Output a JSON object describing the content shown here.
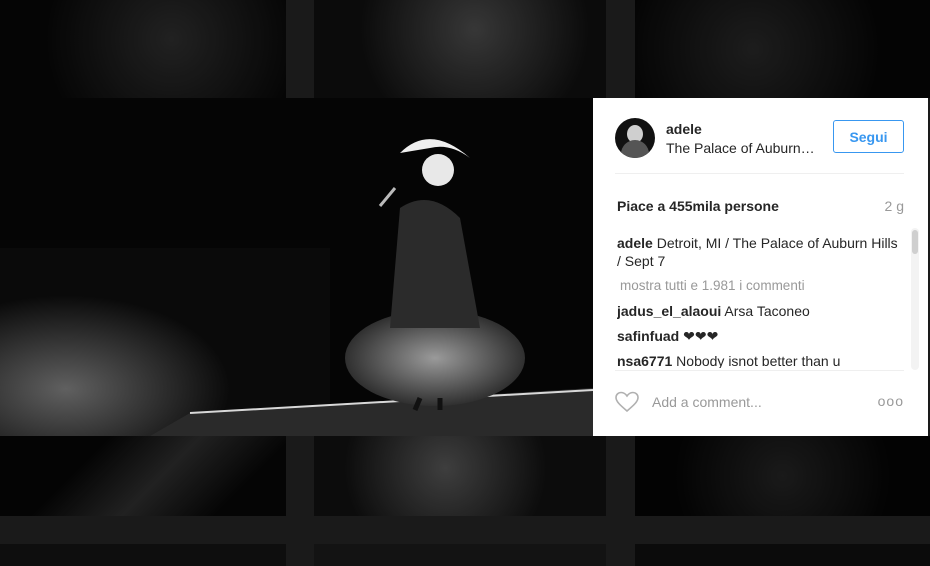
{
  "post": {
    "username": "adele",
    "location": "The Palace of Auburn Hills",
    "follow_label": "Segui",
    "likes_text": "Piace a 455mila persone",
    "age": "2 g",
    "caption": {
      "user": "adele",
      "text": "Detroit, MI / The Palace of Auburn Hills / Sept 7"
    },
    "view_all_comments": "mostra tutti e 1.981 i commenti",
    "comments": [
      {
        "user": "jadus_el_alaoui",
        "text": "Arsa Taconeo"
      },
      {
        "user": "safinfuad",
        "text": "❤❤❤"
      },
      {
        "user": "nsa6771",
        "text": "Nobody isnot better than u"
      }
    ],
    "add_comment_placeholder": "Add a comment...",
    "more_glyph": "ooo"
  },
  "icons": {
    "like": "heart-outline-icon",
    "more": "more-options-icon"
  },
  "colors": {
    "accent": "#3897f0",
    "text": "#262626",
    "muted": "#999999"
  }
}
